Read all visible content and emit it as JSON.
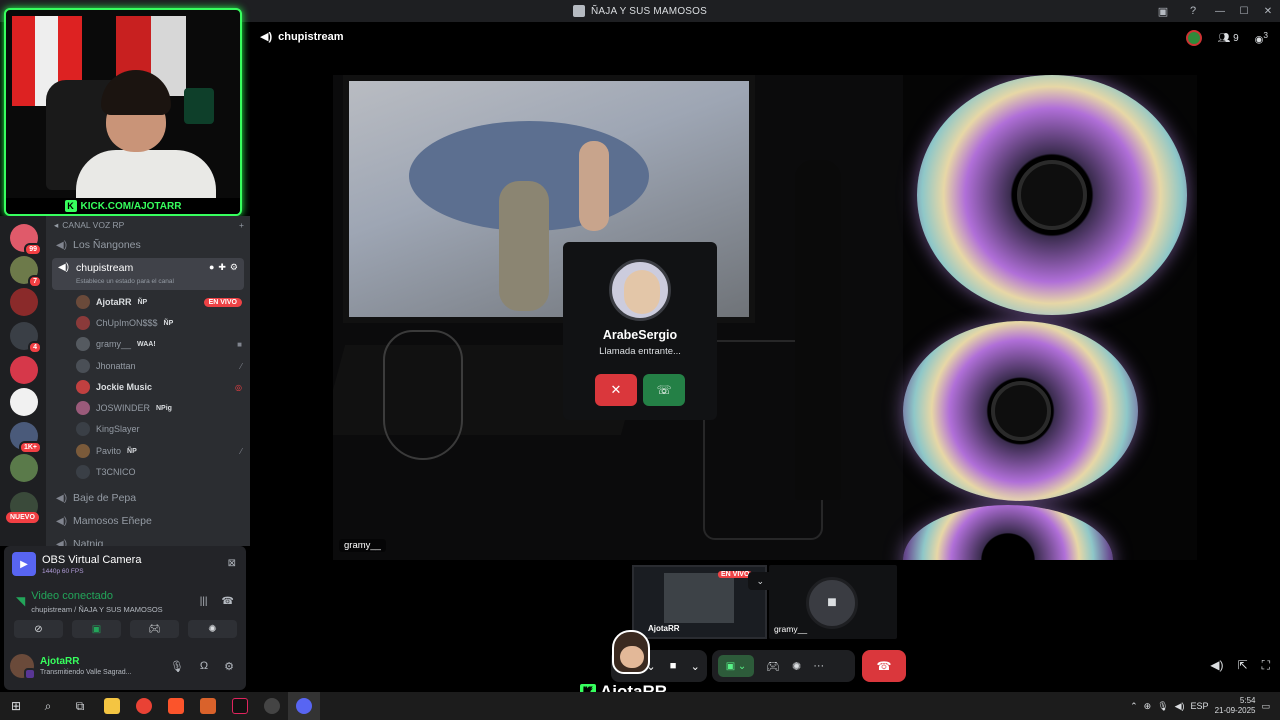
{
  "window": {
    "title": "ÑAJA Y SUS MAMOSOS"
  },
  "webcam": {
    "label": "KICK.COM/AJOTARR"
  },
  "rail": {
    "badges": [
      "99",
      "7",
      "4",
      "1K+"
    ],
    "new_label": "NUEVO"
  },
  "sidebar": {
    "category": "CANAL VOZ RP",
    "channels_top": [
      {
        "name": "Los Ñangones"
      }
    ],
    "active_channel": {
      "name": "chupistream",
      "status": "Establece un estado para el canal"
    },
    "members": [
      {
        "name": "AjotaRR",
        "tag": "ÑP",
        "live": "EN VIVO",
        "avatar_color": "#6a4a3a"
      },
      {
        "name": "ChUpImON$$$",
        "tag": "ÑP",
        "avatar_color": "#8a3a3a"
      },
      {
        "name": "gramy__",
        "tag": "WAA!",
        "avatar_color": "#555a60"
      },
      {
        "name": "Jhonattan",
        "tag": "",
        "avatar_color": "#4a4f56"
      },
      {
        "name": "Jockie Music",
        "tag": "",
        "avatar_color": "#c04040"
      },
      {
        "name": "JOSWINDER",
        "tag": "NPig",
        "avatar_color": "#9a5a7a"
      },
      {
        "name": "KingSlayer",
        "tag": "",
        "avatar_color": "#3a3f46"
      },
      {
        "name": "Pavito",
        "tag": "ÑP",
        "avatar_color": "#7a5a3a"
      },
      {
        "name": "T3CNICO",
        "tag": "",
        "avatar_color": "#3a3f46"
      }
    ],
    "channels_bottom": [
      {
        "name": "Baje de Pepa"
      },
      {
        "name": "Mamosos Eñepe"
      },
      {
        "name": "Natnig"
      }
    ]
  },
  "voice_panel": {
    "camera_name": "OBS Virtual Camera",
    "camera_quality": "1440p 60 FPS",
    "connection_status": "Video conectado",
    "connection_location": "chupistream / ÑAJA Y SUS MAMOSOS",
    "user_name": "AjotaRR",
    "user_status": "Transmitiendo Valle Sagrad..."
  },
  "stage": {
    "channel_name": "chupistream",
    "participant_count": "9",
    "activity_badge": "3",
    "video_label": "gramy__"
  },
  "incoming_call": {
    "caller": "ArabeSergio",
    "status": "Llamada entrante..."
  },
  "thumbnails": [
    {
      "name": "AjotaRR",
      "live": "EN VIVO"
    },
    {
      "name": "gramy__"
    }
  ],
  "overlay": {
    "streamer_name": "AjotaRR"
  },
  "taskbar": {
    "language": "ESP",
    "time": "5:54",
    "date": "21-09-2025"
  },
  "colors": {
    "accent_green": "#37ff5e",
    "discord_green": "#23a55a",
    "discord_red": "#da373c",
    "live_red": "#ed4245"
  }
}
